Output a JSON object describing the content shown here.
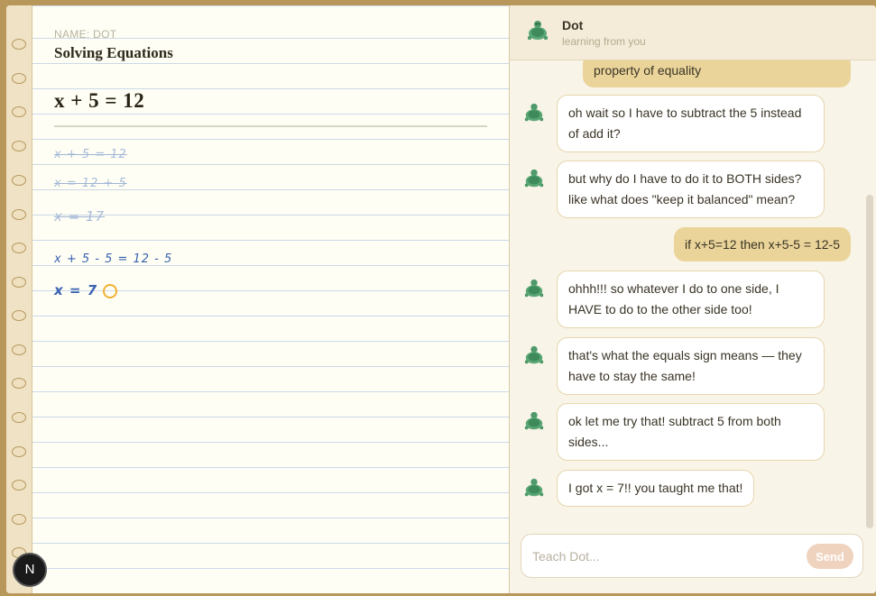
{
  "notebook": {
    "name_label": "NAME: DOT",
    "title": "Solving Equations",
    "equation": "x + 5 = 12",
    "work_lines": [
      {
        "text": "x + 5 = 12",
        "struck": true
      },
      {
        "text": "x = 12 + 5",
        "struck": true
      },
      {
        "text": "x = 17",
        "struck": true
      },
      {
        "text": "x + 5 - 5 = 12 - 5",
        "struck": false
      },
      {
        "text": "x = 7",
        "struck": false
      }
    ]
  },
  "chat": {
    "header": {
      "name": "Dot",
      "subtitle": "learning from you",
      "avatar_icon": "turtle-icon"
    },
    "messages": [
      {
        "from": "user",
        "text": "property of equality"
      },
      {
        "from": "bot",
        "text": "oh wait so I have to subtract the 5 instead of add it?"
      },
      {
        "from": "bot",
        "text": "but why do I have to do it to BOTH sides? like what does \"keep it balanced\" mean?"
      },
      {
        "from": "user",
        "text": "if x+5=12 then x+5-5 = 12-5"
      },
      {
        "from": "bot",
        "text": "ohhh!!! so whatever I do to one side, I HAVE to do to the other side too!"
      },
      {
        "from": "bot",
        "text": "that's what the equals sign means — they have to stay the same!"
      },
      {
        "from": "bot",
        "text": "ok let me try that! subtract 5 from both sides..."
      },
      {
        "from": "bot",
        "text": "I got x = 7!! you taught me that!"
      }
    ],
    "input": {
      "placeholder": "Teach Dot...",
      "value": ""
    },
    "send_label": "Send"
  },
  "badge": {
    "label": "N"
  },
  "colors": {
    "frame": "#b8975a",
    "user_bubble": "#ead49a",
    "ink": "#3a62b0",
    "struck_ink": "#a9bcd9",
    "circle": "#f0b132"
  }
}
